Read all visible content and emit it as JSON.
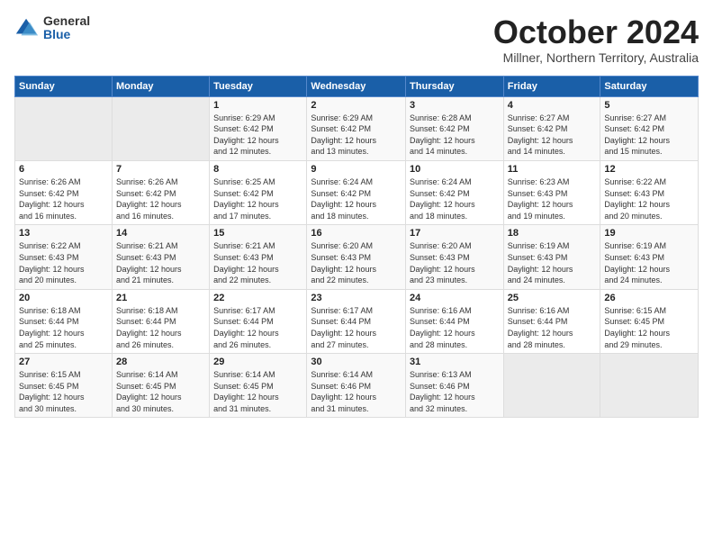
{
  "logo": {
    "general": "General",
    "blue": "Blue"
  },
  "title": "October 2024",
  "location": "Millner, Northern Territory, Australia",
  "days_of_week": [
    "Sunday",
    "Monday",
    "Tuesday",
    "Wednesday",
    "Thursday",
    "Friday",
    "Saturday"
  ],
  "weeks": [
    [
      {
        "day": "",
        "detail": ""
      },
      {
        "day": "",
        "detail": ""
      },
      {
        "day": "1",
        "detail": "Sunrise: 6:29 AM\nSunset: 6:42 PM\nDaylight: 12 hours\nand 12 minutes."
      },
      {
        "day": "2",
        "detail": "Sunrise: 6:29 AM\nSunset: 6:42 PM\nDaylight: 12 hours\nand 13 minutes."
      },
      {
        "day": "3",
        "detail": "Sunrise: 6:28 AM\nSunset: 6:42 PM\nDaylight: 12 hours\nand 14 minutes."
      },
      {
        "day": "4",
        "detail": "Sunrise: 6:27 AM\nSunset: 6:42 PM\nDaylight: 12 hours\nand 14 minutes."
      },
      {
        "day": "5",
        "detail": "Sunrise: 6:27 AM\nSunset: 6:42 PM\nDaylight: 12 hours\nand 15 minutes."
      }
    ],
    [
      {
        "day": "6",
        "detail": "Sunrise: 6:26 AM\nSunset: 6:42 PM\nDaylight: 12 hours\nand 16 minutes."
      },
      {
        "day": "7",
        "detail": "Sunrise: 6:26 AM\nSunset: 6:42 PM\nDaylight: 12 hours\nand 16 minutes."
      },
      {
        "day": "8",
        "detail": "Sunrise: 6:25 AM\nSunset: 6:42 PM\nDaylight: 12 hours\nand 17 minutes."
      },
      {
        "day": "9",
        "detail": "Sunrise: 6:24 AM\nSunset: 6:42 PM\nDaylight: 12 hours\nand 18 minutes."
      },
      {
        "day": "10",
        "detail": "Sunrise: 6:24 AM\nSunset: 6:42 PM\nDaylight: 12 hours\nand 18 minutes."
      },
      {
        "day": "11",
        "detail": "Sunrise: 6:23 AM\nSunset: 6:43 PM\nDaylight: 12 hours\nand 19 minutes."
      },
      {
        "day": "12",
        "detail": "Sunrise: 6:22 AM\nSunset: 6:43 PM\nDaylight: 12 hours\nand 20 minutes."
      }
    ],
    [
      {
        "day": "13",
        "detail": "Sunrise: 6:22 AM\nSunset: 6:43 PM\nDaylight: 12 hours\nand 20 minutes."
      },
      {
        "day": "14",
        "detail": "Sunrise: 6:21 AM\nSunset: 6:43 PM\nDaylight: 12 hours\nand 21 minutes."
      },
      {
        "day": "15",
        "detail": "Sunrise: 6:21 AM\nSunset: 6:43 PM\nDaylight: 12 hours\nand 22 minutes."
      },
      {
        "day": "16",
        "detail": "Sunrise: 6:20 AM\nSunset: 6:43 PM\nDaylight: 12 hours\nand 22 minutes."
      },
      {
        "day": "17",
        "detail": "Sunrise: 6:20 AM\nSunset: 6:43 PM\nDaylight: 12 hours\nand 23 minutes."
      },
      {
        "day": "18",
        "detail": "Sunrise: 6:19 AM\nSunset: 6:43 PM\nDaylight: 12 hours\nand 24 minutes."
      },
      {
        "day": "19",
        "detail": "Sunrise: 6:19 AM\nSunset: 6:43 PM\nDaylight: 12 hours\nand 24 minutes."
      }
    ],
    [
      {
        "day": "20",
        "detail": "Sunrise: 6:18 AM\nSunset: 6:44 PM\nDaylight: 12 hours\nand 25 minutes."
      },
      {
        "day": "21",
        "detail": "Sunrise: 6:18 AM\nSunset: 6:44 PM\nDaylight: 12 hours\nand 26 minutes."
      },
      {
        "day": "22",
        "detail": "Sunrise: 6:17 AM\nSunset: 6:44 PM\nDaylight: 12 hours\nand 26 minutes."
      },
      {
        "day": "23",
        "detail": "Sunrise: 6:17 AM\nSunset: 6:44 PM\nDaylight: 12 hours\nand 27 minutes."
      },
      {
        "day": "24",
        "detail": "Sunrise: 6:16 AM\nSunset: 6:44 PM\nDaylight: 12 hours\nand 28 minutes."
      },
      {
        "day": "25",
        "detail": "Sunrise: 6:16 AM\nSunset: 6:44 PM\nDaylight: 12 hours\nand 28 minutes."
      },
      {
        "day": "26",
        "detail": "Sunrise: 6:15 AM\nSunset: 6:45 PM\nDaylight: 12 hours\nand 29 minutes."
      }
    ],
    [
      {
        "day": "27",
        "detail": "Sunrise: 6:15 AM\nSunset: 6:45 PM\nDaylight: 12 hours\nand 30 minutes."
      },
      {
        "day": "28",
        "detail": "Sunrise: 6:14 AM\nSunset: 6:45 PM\nDaylight: 12 hours\nand 30 minutes."
      },
      {
        "day": "29",
        "detail": "Sunrise: 6:14 AM\nSunset: 6:45 PM\nDaylight: 12 hours\nand 31 minutes."
      },
      {
        "day": "30",
        "detail": "Sunrise: 6:14 AM\nSunset: 6:46 PM\nDaylight: 12 hours\nand 31 minutes."
      },
      {
        "day": "31",
        "detail": "Sunrise: 6:13 AM\nSunset: 6:46 PM\nDaylight: 12 hours\nand 32 minutes."
      },
      {
        "day": "",
        "detail": ""
      },
      {
        "day": "",
        "detail": ""
      }
    ]
  ]
}
